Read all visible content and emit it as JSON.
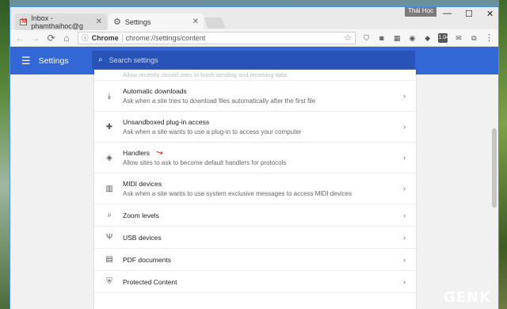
{
  "tabs": [
    {
      "label": "Inbox - phamthaihoc@g",
      "close": "✕"
    },
    {
      "label": "Settings",
      "close": "✕"
    }
  ],
  "window": {
    "user": "Thái Học",
    "minimize": "—",
    "maximize": "☐",
    "close": "✕"
  },
  "toolbar": {
    "back": "←",
    "forward": "→",
    "reload": "⟳",
    "home": "⌂",
    "scheme": "Chrome",
    "url": "chrome://settings/content",
    "star": "☆",
    "extensions": [
      "⛉",
      "◙",
      "▦",
      "◉",
      "◆",
      "1.04",
      "✉",
      "⧉"
    ],
    "menu": "⋮"
  },
  "appbar": {
    "title": "Settings",
    "search_placeholder": "Search settings"
  },
  "faded_text": "Allow recently closed sites to finish sending and receiving data",
  "rows": [
    {
      "title": "Automatic downloads",
      "desc": "Ask when a site tries to download files automatically after the first file",
      "icon": "⤓"
    },
    {
      "title": "Unsandboxed plug-in access",
      "desc": "Ask when a site wants to use a plug-in to access your computer",
      "icon": "✚"
    },
    {
      "title": "Handlers",
      "desc": "Allow sites to ask to become default handlers for protocols",
      "icon": "◈"
    },
    {
      "title": "MIDI devices",
      "desc": "Ask when a site wants to use system exclusive messages to access MIDI devices",
      "icon": "▥"
    },
    {
      "title": "Zoom levels",
      "icon": "⌕"
    },
    {
      "title": "USB devices",
      "icon": "Ψ"
    },
    {
      "title": "PDF documents",
      "icon": "▤"
    },
    {
      "title": "Protected Content",
      "icon": "⛨"
    }
  ],
  "chevron": "›",
  "annotation_arrow": "➘",
  "watermark": "GENK",
  "colors": {
    "appbar": "#3367d6",
    "search": "#2854b8",
    "arrow": "#e02020"
  }
}
